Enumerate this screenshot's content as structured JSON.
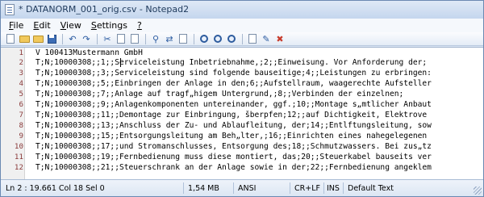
{
  "window": {
    "title": "* DATANORM_001_orig.csv - Notepad2"
  },
  "menu": [
    {
      "label": "File",
      "u": "F",
      "rest": "ile"
    },
    {
      "label": "Edit",
      "u": "E",
      "rest": "dit"
    },
    {
      "label": "View",
      "u": "V",
      "rest": "iew"
    },
    {
      "label": "Settings",
      "u": "S",
      "rest": "ettings"
    },
    {
      "label": "?",
      "u": "?",
      "rest": ""
    }
  ],
  "editor": {
    "lines": [
      {
        "n": "1",
        "text": "V 100413Mustermann GmbH"
      },
      {
        "n": "2",
        "text": "T;N;10000308;;1;;Serviceleistung Inbetriebnahme,;2;;Einweisung. Vor Anforderung der;"
      },
      {
        "n": "3",
        "text": "T;N;10000308;;3;;Serviceleistung sind folgende bauseitige;4;;Leistungen zu erbringen:"
      },
      {
        "n": "4",
        "text": "T;N;10000308;;5;;Einbringen der Anlage in den;6;;Aufstellraum, waagerechte Aufsteller"
      },
      {
        "n": "5",
        "text": "T;N;10000308;;7;;Anlage auf tragf„higem Untergrund,;8;;Verbinden der einzelnen;"
      },
      {
        "n": "6",
        "text": "T;N;10000308;;9;;Anlagenkomponenten untereinander, ggf.;10;;Montage s„mtlicher Anbaut"
      },
      {
        "n": "7",
        "text": "T;N;10000308;;11;;Demontage zur Einbringung, šberpfen;12;;auf Dichtigkeit, Elektrove"
      },
      {
        "n": "8",
        "text": "T;N;10000308;;13;;Anschluss der Zu- und Ablaufleitung, der;14;;Entlftungsleitung, sow"
      },
      {
        "n": "9",
        "text": "T;N;10000308;;15;;Entsorgungsleitung am Beh„lter,;16;;Einrichten eines nahegelegenen"
      },
      {
        "n": "10",
        "text": "T;N;10000308;;17;;und Stromanschlusses, Entsorgung des;18;;Schmutzwassers. Bei zus„tz"
      },
      {
        "n": "11",
        "text": "T;N;10000308;;19;;Fernbedienung muss diese montiert, das;20;;Steuerkabel bauseits ver"
      },
      {
        "n": "12",
        "text": "T;N;10000308;;21;;Steuerschrank an der Anlage sowie in der;22;;Fernbedienung angeklem"
      }
    ]
  },
  "status": {
    "position": "Ln 2 : 19.661   Col 18   Sel 0",
    "size": "1,54 MB",
    "encoding": "ANSI",
    "line_endings": "CR+LF",
    "mode": "INS",
    "scheme": "Default Text"
  },
  "colors": {
    "line_number": "#8a3a3a",
    "title_text": "#1e395b"
  }
}
